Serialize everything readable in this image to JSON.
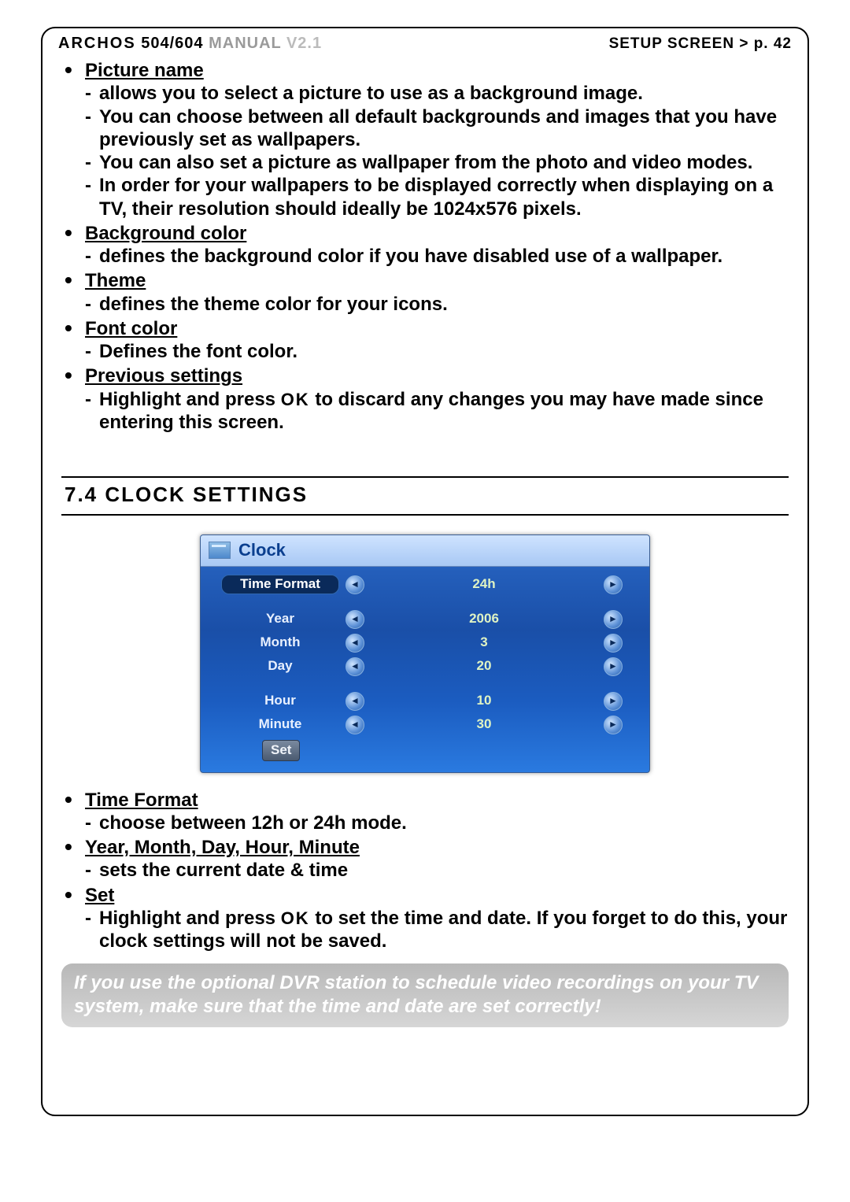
{
  "header": {
    "brand": "ARCHOS",
    "model": "504/604",
    "manual": "MANUAL",
    "version": "V2.1",
    "right": "SETUP SCREEN  >  p. 42"
  },
  "display_settings": [
    {
      "title": "Picture name",
      "subs": [
        "allows you to select a picture to use as a background image.",
        "You can choose between all default backgrounds and images that you have previously set as wallpapers.",
        "You can also set a picture as wallpaper from the photo and video modes.",
        "In order for your wallpapers to be displayed correctly when displaying on a TV, their resolution should ideally be 1024x576 pixels."
      ]
    },
    {
      "title": "Background color",
      "subs": [
        "defines the background color if you have disabled use of a wallpaper."
      ]
    },
    {
      "title": "Theme",
      "subs": [
        "defines the theme color for your icons."
      ]
    },
    {
      "title": "Font color",
      "subs": [
        "Defines the font color."
      ]
    },
    {
      "title": "Previous settings",
      "ok_index": 0,
      "subs_pre": "Highlight and press ",
      "subs_post": " to discard any changes you may have made since entering this screen."
    }
  ],
  "section_heading": "7.4  Clock Settings",
  "clock_panel": {
    "title": "Clock",
    "rows": [
      {
        "label": "Time Format",
        "value": "24h",
        "selected": true
      },
      {
        "gap": true
      },
      {
        "label": "Year",
        "value": "2006"
      },
      {
        "label": "Month",
        "value": "3"
      },
      {
        "label": "Day",
        "value": "20"
      },
      {
        "gap": true
      },
      {
        "label": "Hour",
        "value": "10"
      },
      {
        "label": "Minute",
        "value": "30"
      }
    ],
    "set_label": "Set"
  },
  "clock_settings": [
    {
      "title": "Time Format",
      "subs": [
        "choose between 12h or 24h mode."
      ]
    },
    {
      "title": "Year, Month, Day, Hour, Minute",
      "subs": [
        "sets the current date & time"
      ]
    },
    {
      "title": "Set",
      "ok_index": 0,
      "subs_pre": "Highlight and press ",
      "subs_post": " to set the time and date. If you forget to do this, your clock settings will not be saved."
    }
  ],
  "ok_label": "OK",
  "note": "If you use the optional DVR station to schedule video recordings on your TV system, make sure that the time and date are set correctly!"
}
